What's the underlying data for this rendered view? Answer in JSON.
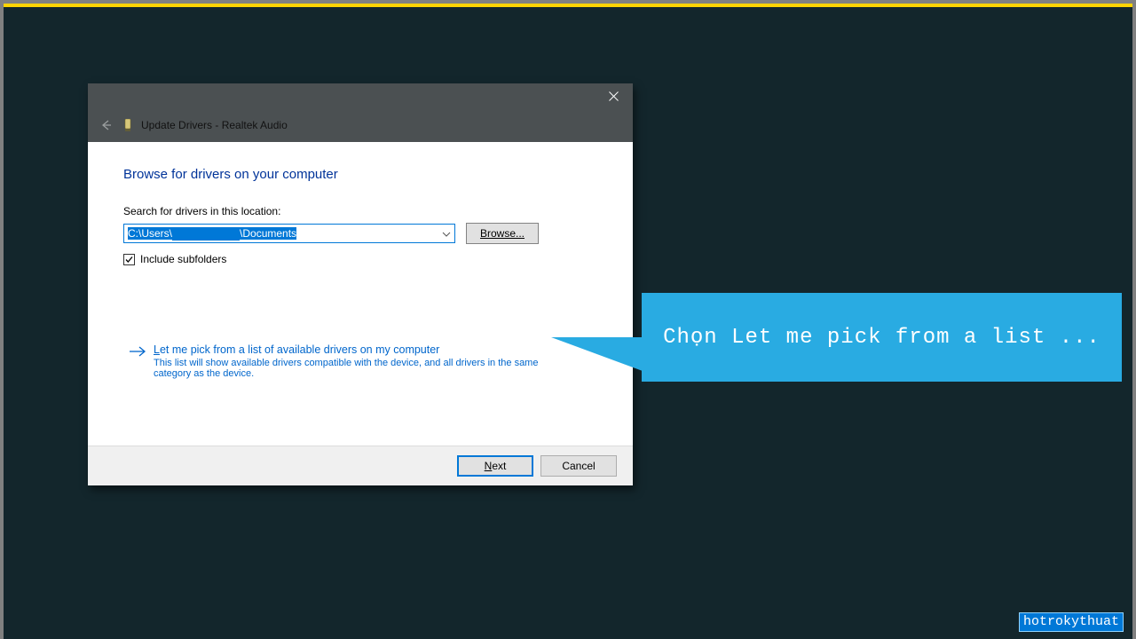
{
  "dialog": {
    "title": "Update Drivers - Realtek Audio",
    "heading": "Browse for drivers on your computer",
    "search_label": "Search for drivers in this location:",
    "path_prefix": "C:\\Users\\",
    "path_suffix": "\\Documents",
    "browse_label": "Browse...",
    "include_subfolders": "Include subfolders",
    "include_subfolders_checked": true,
    "link_title_ul_char": "L",
    "link_title_rest": "et me pick from a list of available drivers on my computer",
    "link_desc": "This list will show available drivers compatible with the device, and all drivers in the same category as the device.",
    "next_u": "N",
    "next_rest": "ext",
    "cancel": "Cancel"
  },
  "callout": {
    "text": "Chọn Let me pick from a list ..."
  },
  "watermark": "hotrokythuat"
}
